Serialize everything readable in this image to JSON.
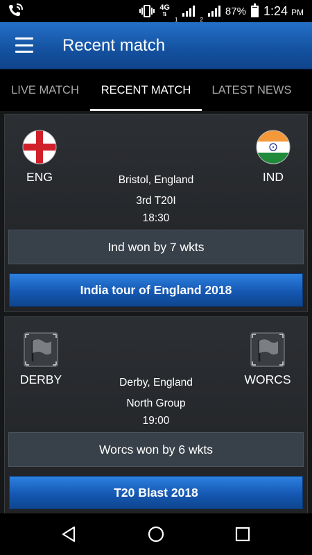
{
  "status_bar": {
    "network": "4G",
    "sim1": "1",
    "sim2": "2",
    "battery": "87%",
    "time": "1:24",
    "ampm": "PM"
  },
  "app_bar": {
    "title": "Recent match"
  },
  "tabs": [
    {
      "label": "LIVE MATCH",
      "active": false
    },
    {
      "label": "RECENT MATCH",
      "active": true
    },
    {
      "label": "LATEST NEWS",
      "active": false
    }
  ],
  "matches": [
    {
      "team1": "ENG",
      "team2": "IND",
      "venue": "Bristol, England",
      "match_type": "3rd T20I",
      "time": "18:30",
      "result": "Ind won by 7 wkts",
      "series": "India tour of England 2018"
    },
    {
      "team1": "DERBY",
      "team2": "WORCS",
      "venue": "Derby, England",
      "match_type": "North Group",
      "time": "19:00",
      "result": "Worcs won by 6 wkts",
      "series": "T20 Blast 2018"
    }
  ],
  "colors": {
    "app_bar": "#14519f",
    "accent_button": "#1558b3",
    "result_box": "#384149",
    "card": "#2c2f33"
  },
  "icons": {
    "menu": "hamburger-menu-icon",
    "back": "nav-back-icon",
    "home": "nav-home-icon",
    "recents": "nav-recents-icon"
  }
}
